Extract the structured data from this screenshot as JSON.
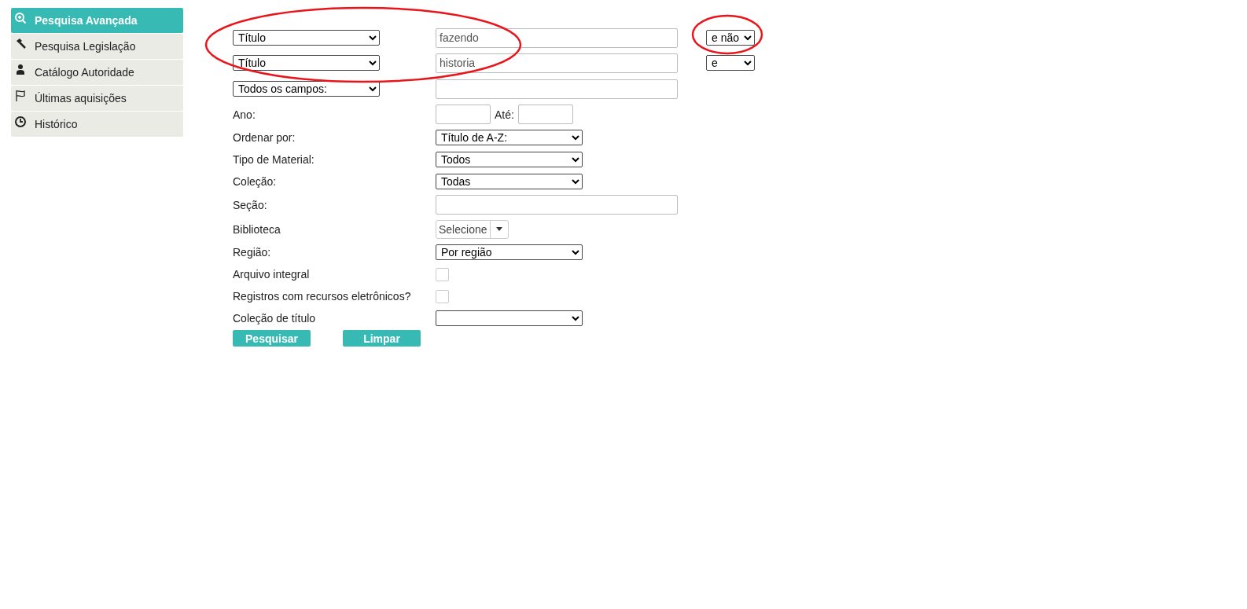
{
  "sidebar": {
    "items": [
      {
        "label": "Pesquisa Avançada",
        "selected": true
      },
      {
        "label": "Pesquisa Legislação",
        "selected": false
      },
      {
        "label": "Catálogo Autoridade",
        "selected": false
      },
      {
        "label": "Últimas aquisições",
        "selected": false
      },
      {
        "label": "Histórico",
        "selected": false
      }
    ]
  },
  "search_rows": [
    {
      "field": "Título",
      "term": "fazendo",
      "operator": "e não"
    },
    {
      "field": "Título",
      "term": "historia",
      "operator": "e"
    },
    {
      "field": "Todos os campos:",
      "term": ""
    }
  ],
  "filters": [
    {
      "kind": "range",
      "label": "Ano:",
      "between": "Até:"
    },
    {
      "kind": "select",
      "label": "Ordenar por:",
      "value": "Título de A-Z:"
    },
    {
      "kind": "select",
      "label": "Tipo de Material:",
      "value": "Todos"
    },
    {
      "kind": "select",
      "label": "Coleção:",
      "value": "Todas"
    },
    {
      "kind": "input",
      "label": "Seção:"
    },
    {
      "kind": "combo",
      "label": "Biblioteca",
      "value": "Selecione"
    },
    {
      "kind": "select",
      "label": "Região:",
      "value": "Por região"
    },
    {
      "kind": "checkbox",
      "label": "Arquivo integral",
      "checked": false
    },
    {
      "kind": "checkbox",
      "label": "Registros com recursos eletrônicos?",
      "checked": false
    },
    {
      "kind": "select",
      "label": "Coleção de título"
    }
  ],
  "buttons": [
    "Pesquisar",
    "Limpar"
  ]
}
